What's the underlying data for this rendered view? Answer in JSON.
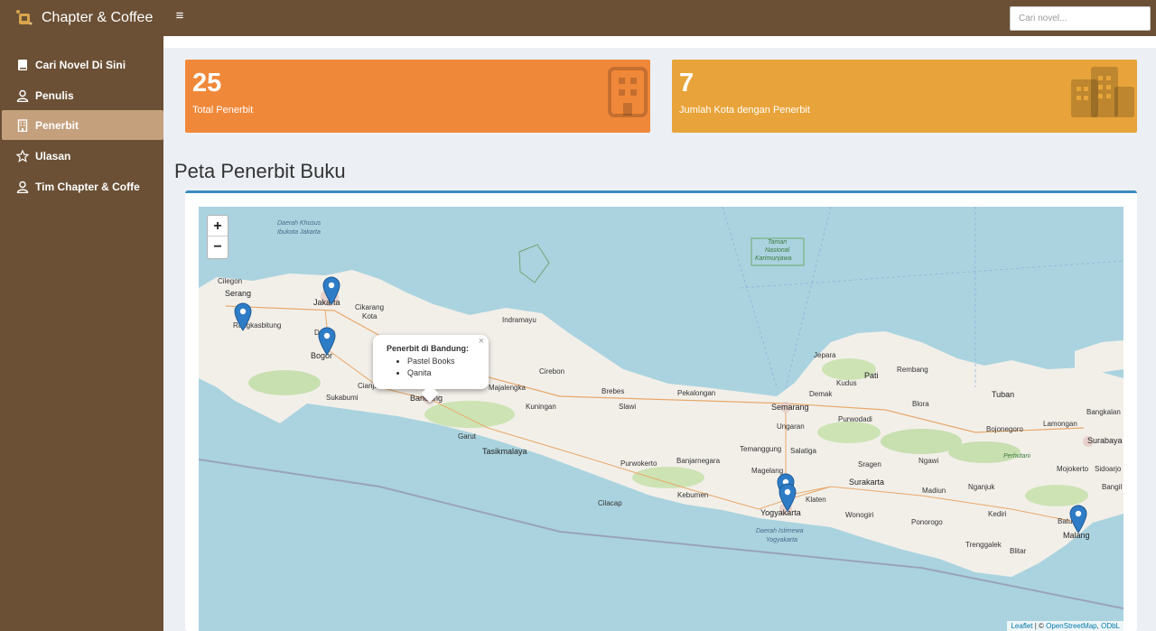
{
  "header": {
    "app_title": "Chapter & Coffee",
    "menu_toggle": "≡",
    "search_placeholder": "Cari novel..."
  },
  "sidebar": {
    "items": [
      {
        "label": "Cari Novel Di Sini",
        "icon": "book-icon"
      },
      {
        "label": "Penulis",
        "icon": "user-icon"
      },
      {
        "label": "Penerbit",
        "icon": "building-icon",
        "active": true
      },
      {
        "label": "Ulasan",
        "icon": "star-icon"
      },
      {
        "label": "Tim Chapter & Coffe",
        "icon": "user-icon"
      }
    ]
  },
  "stats": {
    "total_publishers": {
      "value": "25",
      "label": "Total Penerbit",
      "color": "#f0883a"
    },
    "cities": {
      "value": "7",
      "label": "Jumlah Kota dengan Penerbit",
      "color": "#e8a43a"
    }
  },
  "page_title": "Peta Penerbit Buku",
  "map": {
    "zoom_in": "+",
    "zoom_out": "−",
    "popup": {
      "title": "Penerbit di Bandung:",
      "items": [
        "Pastel Books",
        "Qanita"
      ],
      "close": "×"
    },
    "attribution_leaflet": "Leaflet",
    "attribution_sep": " | © ",
    "attribution_osm": "OpenStreetMap",
    "attribution_odbl": "ODbL",
    "labels": {
      "dki": "Daerah Khusus",
      "dki2": "Ibukota Jakarta",
      "karimun": "Taman",
      "karimun2": "Nasional",
      "karimun3": "Karimunjawa",
      "serang": "Serang",
      "cilegon": "Cilegon",
      "rangkasbitung": "Rangkasbitung",
      "jakarta": "Jakarta",
      "depok": "Depok",
      "bogor": "Bogor",
      "cikarang": "Cikarang",
      "kota": "Kota",
      "cianjur": "Cianjur",
      "sukabumi": "Sukabumi",
      "indramayu": "Indramayu",
      "cirebon": "Cirebon",
      "majalengka": "Majalengka",
      "kuningan": "Kuningan",
      "bandung": "Bandung",
      "garut": "Garut",
      "tasikmalaya": "Tasikmalaya",
      "brebes": "Brebes",
      "slawi": "Slawi",
      "pekalongan": "Pekalongan",
      "purwokerto": "Purwokerto",
      "banjarnegara": "Banjarnegara",
      "cilacap": "Cilacap",
      "kebumen": "Kebumen",
      "magelang": "Magelang",
      "yogyakarta": "Yogyakarta",
      "diy": "Daerah Istimewa",
      "diy2": "Yogyakarta",
      "semarang": "Semarang",
      "ungaran": "Ungaran",
      "salatiga": "Salatiga",
      "temanggung": "Temanggung",
      "demak": "Demak",
      "kudus": "Kudus",
      "pati": "Pati",
      "jepara": "Jepara",
      "rembang": "Rembang",
      "purwodadi": "Purwodadi",
      "surakarta": "Surakarta",
      "sragen": "Sragen",
      "klaten": "Klaten",
      "wonogiri": "Wonogiri",
      "ngawi": "Ngawi",
      "madiun": "Madiun",
      "ponorogo": "Ponorogo",
      "trenggalek": "Trenggalek",
      "blora": "Blora",
      "tuban": "Tuban",
      "bojonegoro": "Bojonegoro",
      "lamongan": "Lamongan",
      "surabaya": "Surabaya",
      "bangkalan": "Bangkalan",
      "mojokerto": "Mojokerto",
      "sidoarjo": "Sidoarjo",
      "bangil": "Bangil",
      "nganjuk": "Nganjuk",
      "kediri": "Kediri",
      "blitar": "Blitar",
      "batu": "Batu",
      "malang": "Malang",
      "perhutani": "Perhutani"
    }
  }
}
